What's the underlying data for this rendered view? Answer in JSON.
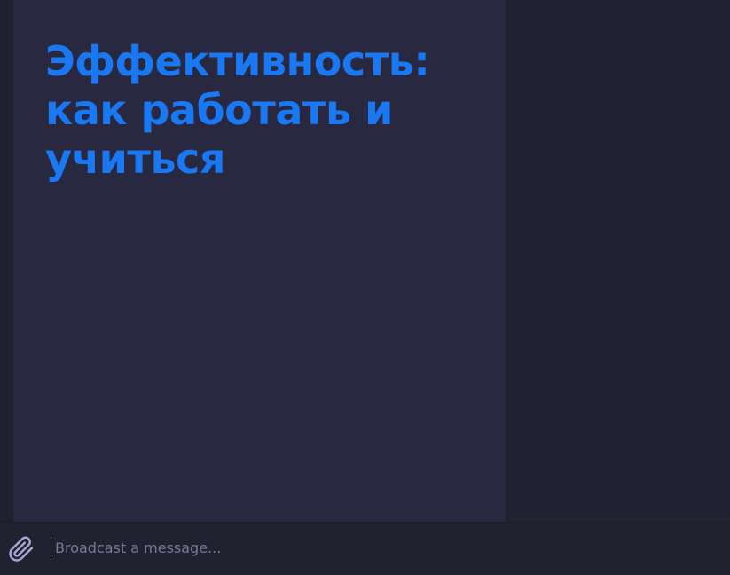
{
  "message": {
    "title": "Эффективность: как работать и учиться"
  },
  "composer": {
    "placeholder": "Broadcast a message...",
    "attach_icon": "paperclip-icon"
  },
  "colors": {
    "background": "#22212f",
    "card": "#282840",
    "title_accent": "#1a78f2",
    "icon": "#a9a4cf"
  }
}
